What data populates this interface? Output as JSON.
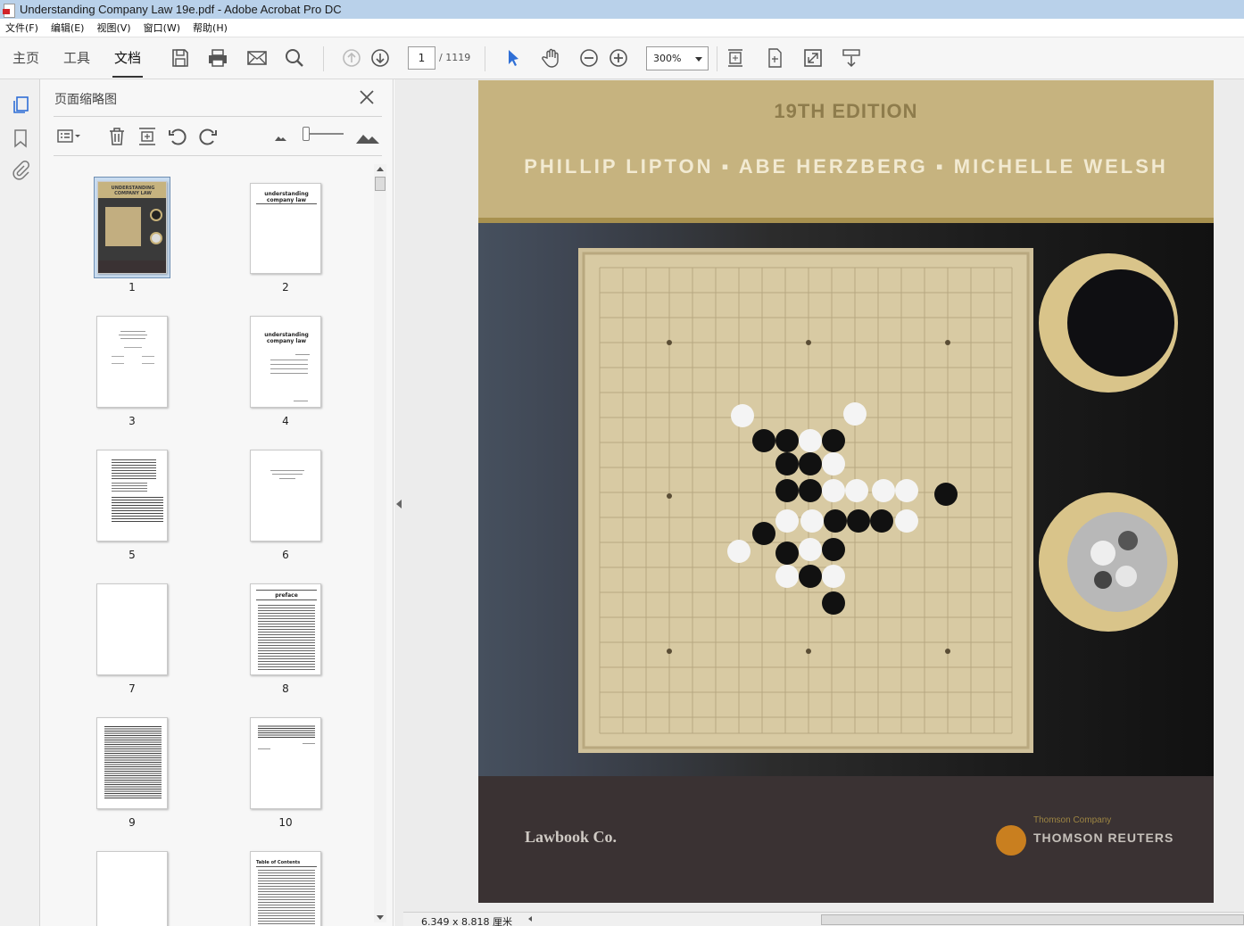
{
  "window": {
    "title": "Understanding Company Law 19e.pdf - Adobe Acrobat Pro DC"
  },
  "menu": [
    "文件(F)",
    "编辑(E)",
    "视图(V)",
    "窗口(W)",
    "帮助(H)"
  ],
  "toolbar": {
    "tabs": [
      "主页",
      "工具",
      "文档"
    ],
    "active_tab": "文档",
    "page_current": "1",
    "page_total": "/ 1119",
    "zoom": "300%"
  },
  "thumbnails_panel": {
    "title": "页面缩略图",
    "pages": [
      {
        "num": "1",
        "selected": true
      },
      {
        "num": "2",
        "heading": "understanding company law"
      },
      {
        "num": "3"
      },
      {
        "num": "4",
        "heading": "understanding company law"
      },
      {
        "num": "5"
      },
      {
        "num": "6"
      },
      {
        "num": "7"
      },
      {
        "num": "8",
        "heading": "preface"
      },
      {
        "num": "9"
      },
      {
        "num": "10"
      },
      {
        "num": ""
      },
      {
        "num": "",
        "heading": "Table of Contents"
      }
    ],
    "cover_thumb_title": "UNDERSTANDING COMPANY LAW"
  },
  "cover": {
    "edition": "19TH EDITION",
    "authors": "PHILLIP LIPTON  ▪  ABE HERZBERG  ▪  MICHELLE WELSH",
    "publisher": "Lawbook Co.",
    "company_tag": "Thomson Company",
    "company": "THOMSON REUTERS"
  },
  "status": {
    "page_size": "6.349 x 8.818 厘米"
  },
  "colors": {
    "titlebar": "#b9d1ea",
    "cover_gold": "#c6b37f",
    "cover_dark": "#3a3233",
    "selection": "#c9dcf0"
  }
}
